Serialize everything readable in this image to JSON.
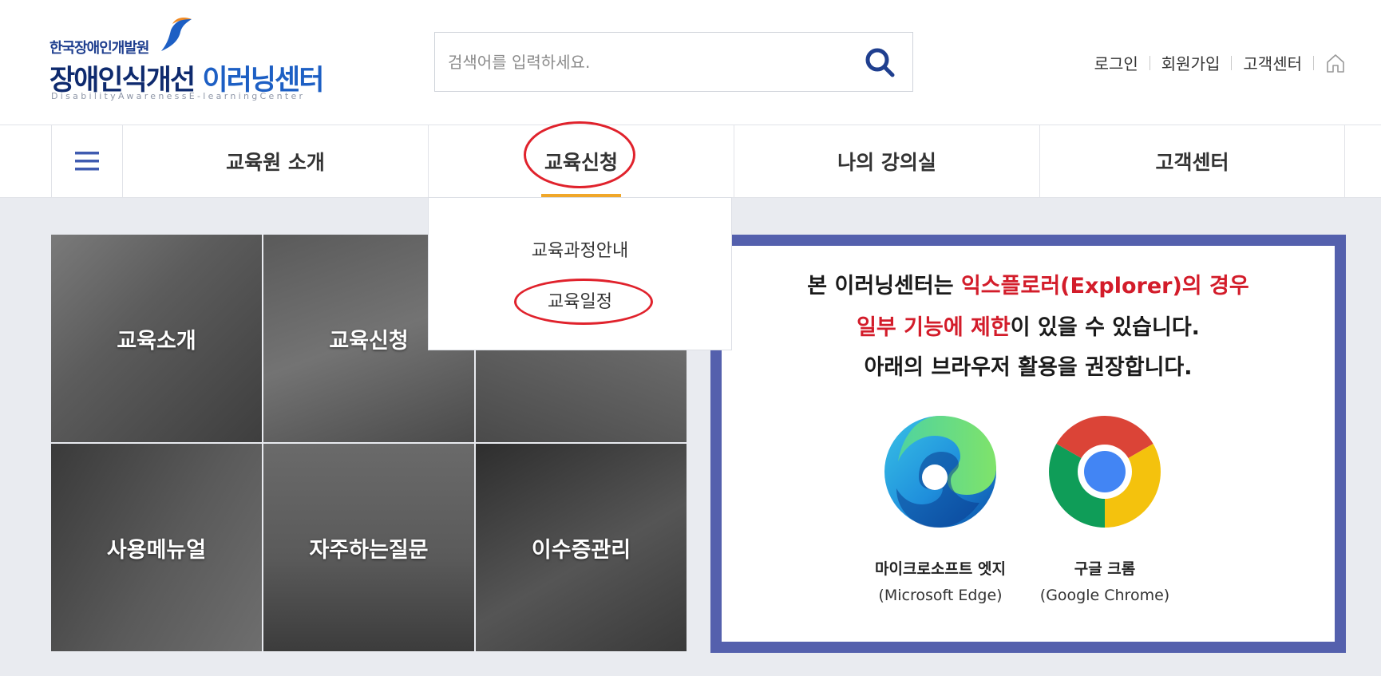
{
  "header": {
    "logo": {
      "org": "한국장애인개발원",
      "title_main": "장애인식개선",
      "title_accent": "이러닝센터",
      "subtitle": "DisabilityAwarenessE-learningCenter"
    },
    "search": {
      "placeholder": "검색어를 입력하세요."
    },
    "util_links": [
      "로그인",
      "회원가입",
      "고객센터"
    ]
  },
  "gnb": {
    "items": [
      "교육원 소개",
      "교육신청",
      "나의 강의실",
      "고객센터"
    ],
    "active_index": 1
  },
  "dropdown": {
    "items": [
      "교육과정안내",
      "교육일정"
    ]
  },
  "tiles": [
    "교육소개",
    "교육신청",
    "",
    "사용메뉴얼",
    "자주하는질문",
    "이수증관리"
  ],
  "notice": {
    "line1_prefix": "본 이러닝센터는 ",
    "line1_red": "익스플로러(Explorer)의 경우",
    "line2_red": "일부 기능에 제한",
    "line2_suffix": "이 있을 수 있습니다.",
    "line3": "아래의 브라우저 활용을 권장합니다.",
    "browsers": [
      {
        "name": "마이크로소프트 엣지",
        "eng": "(Microsoft Edge)",
        "icon": "edge-icon"
      },
      {
        "name": "구글 크롬",
        "eng": "(Google Chrome)",
        "icon": "chrome-icon"
      }
    ]
  },
  "colors": {
    "accent_orange": "#f0a72a",
    "annotation_red": "#e0222c",
    "notice_border": "#5460ad",
    "notice_red": "#d31c2a",
    "logo_navy": "#0e2a6e",
    "logo_blue": "#1d5fc4"
  }
}
